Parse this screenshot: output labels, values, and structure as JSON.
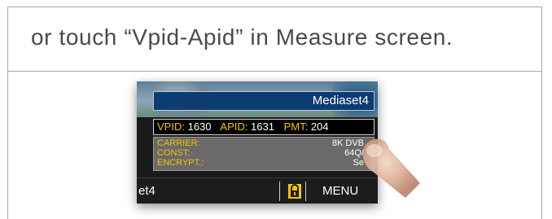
{
  "instruction": {
    "text": "or touch “Vpid-Apid” in Measure screen."
  },
  "screen": {
    "channel_name": "Mediaset4",
    "pids": {
      "vpid_label": "VPID:",
      "vpid_value": "1630",
      "apid_label": "APID:",
      "apid_value": "1631",
      "pmt_label": "PMT:",
      "pmt_value": "204"
    },
    "info": [
      {
        "key": "CARRIER:",
        "value": "8K DVB"
      },
      {
        "key": "CONST:",
        "value": "64Q/"
      },
      {
        "key": "ENCRYPT.:",
        "value": "Se"
      }
    ],
    "bottom_bar": {
      "channel_partial": "et4",
      "menu_label": "MENU",
      "lock_icon": "lock-icon"
    }
  },
  "colors": {
    "label_yellow": "#f2c200",
    "channel_bar_blue": "#0d3b73",
    "lock_yellow": "#f5c400"
  }
}
